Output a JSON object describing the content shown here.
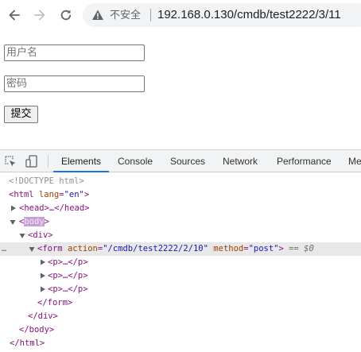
{
  "browser": {
    "security_label": "不安全",
    "url": "192.168.0.130/cmdb/test2222/3/11"
  },
  "form": {
    "username_placeholder": "用户名",
    "password_placeholder": "密码",
    "submit_label": "提交"
  },
  "devtools": {
    "tabs": [
      "Elements",
      "Console",
      "Sources",
      "Network",
      "Performance",
      "Me"
    ],
    "active_tab": "Elements",
    "tree": {
      "doctype": "<!DOCTYPE html>",
      "html_open_tag": "<html",
      "html_lang_attr": "lang",
      "html_lang_val": "\"en\"",
      "html_open_end": ">",
      "head_collapsed": "<head>…</head>",
      "body_open": "<",
      "body_name": "body",
      "body_close": ">",
      "div_open": "<div>",
      "form_open": "<form",
      "form_action_attr": "action",
      "form_action_val": "\"/cmdb/test2222/2/10\"",
      "form_method_attr": "method",
      "form_method_val": "\"post\"",
      "form_open_end": ">",
      "selected_marker": "== $0",
      "p_collapsed": "<p>…</p>",
      "form_close": "</form>",
      "div_close": "</div>",
      "body_close_tag": "</body>",
      "html_close": "</html>",
      "row_dots": "…"
    }
  }
}
